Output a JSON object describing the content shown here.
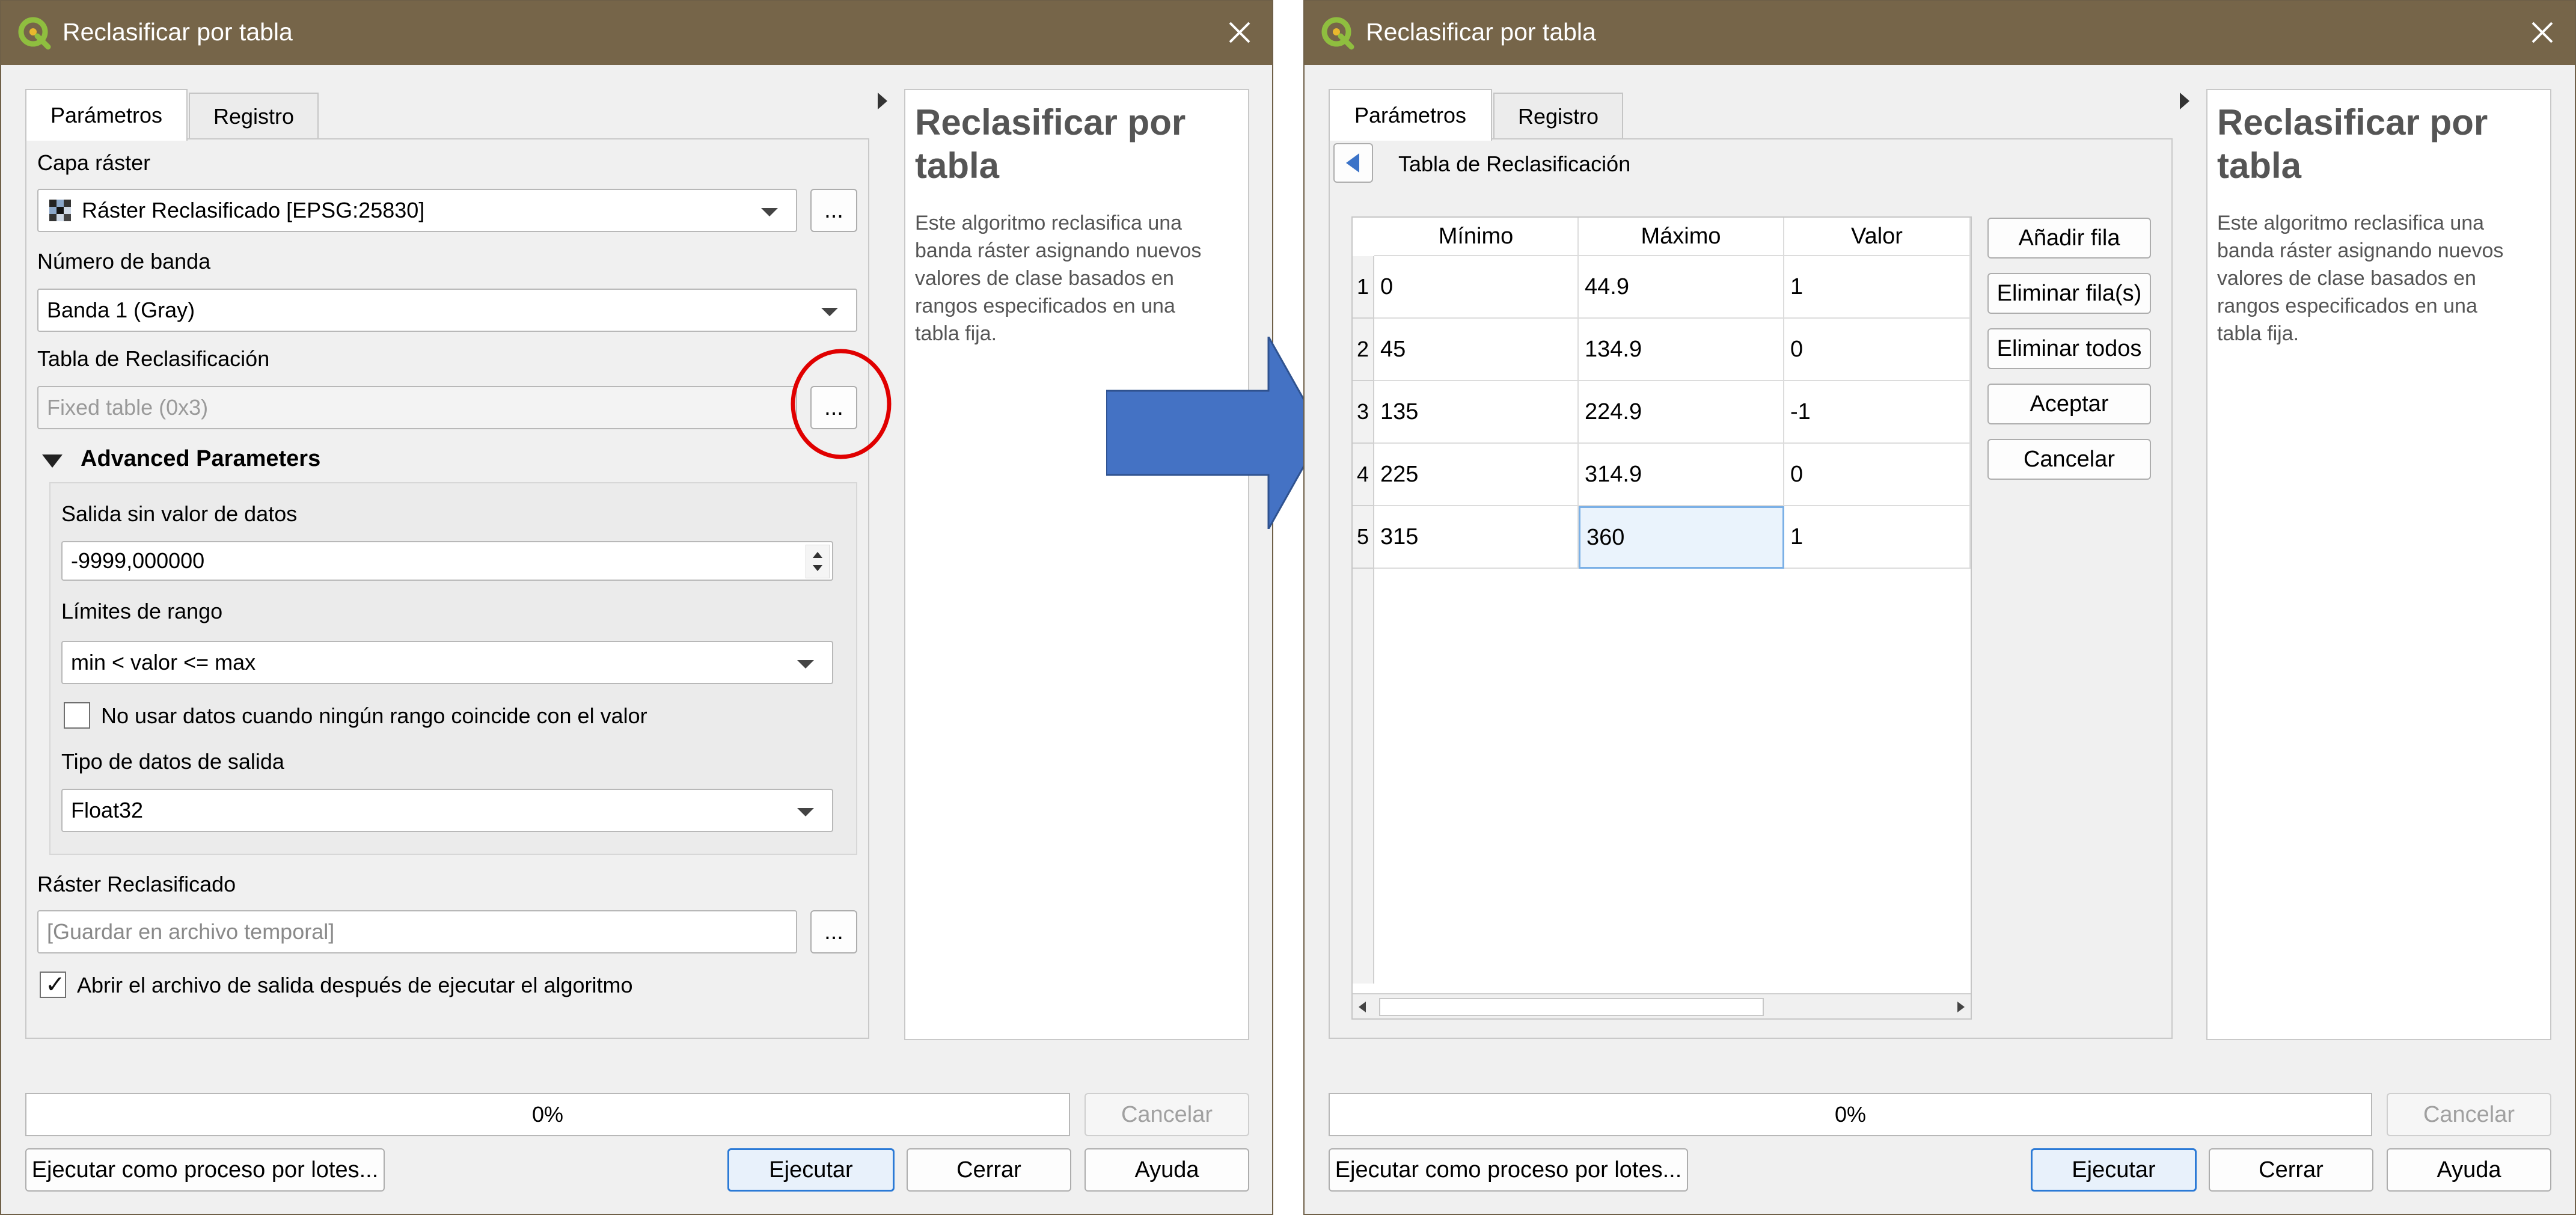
{
  "left_dialog": {
    "title": "Reclasificar por tabla",
    "tabs": [
      "Parámetros",
      "Registro"
    ],
    "capa_raster": {
      "label": "Capa ráster",
      "value": "Ráster Reclasificado [EPSG:25830]"
    },
    "numero_banda": {
      "label": "Número de banda",
      "value": "Banda 1 (Gray)"
    },
    "tabla": {
      "label": "Tabla de Reclasificación",
      "value": "Fixed table (0x3)"
    },
    "browse_label": "...",
    "advanced": {
      "header": "Advanced Parameters",
      "nodata": {
        "label": "Salida sin valor de datos",
        "value": "-9999,000000"
      },
      "limites": {
        "label": "Límites de rango",
        "value": "min < valor <= max"
      },
      "no_usar": {
        "label": "No usar datos cuando ningún rango coincide con el valor",
        "checked": false
      },
      "tipo": {
        "label": "Tipo de datos de salida",
        "value": "Float32"
      }
    },
    "raster_out": {
      "label": "Ráster Reclasificado",
      "placeholder": "[Guardar en archivo temporal]"
    },
    "abrir": {
      "label": "Abrir el archivo de salida después de ejecutar el algoritmo",
      "checked": true
    },
    "progress": "0%",
    "cancel_label": "Cancelar",
    "batch_label": "Ejecutar como proceso por lotes...",
    "run_label": "Ejecutar",
    "close_label": "Cerrar",
    "help_label": "Ayuda",
    "help": {
      "title_lines": [
        "Reclasificar por",
        "tabla"
      ],
      "text_lines": [
        "Este algoritmo reclasifica una",
        "banda ráster asignando nuevos",
        "valores de clase basados en",
        "rangos especificados en una",
        "tabla fija."
      ]
    }
  },
  "right_dialog": {
    "title": "Reclasificar por tabla",
    "tabs": [
      "Parámetros",
      "Registro"
    ],
    "panel_title": "Tabla de Reclasificación",
    "columns": [
      "Mínimo",
      "Máximo",
      "Valor"
    ],
    "rows": [
      {
        "n": "1",
        "min": "0",
        "max": "44.9",
        "val": "1"
      },
      {
        "n": "2",
        "min": "45",
        "max": "134.9",
        "val": "0"
      },
      {
        "n": "3",
        "min": "135",
        "max": "224.9",
        "val": "-1"
      },
      {
        "n": "4",
        "min": "225",
        "max": "314.9",
        "val": "0"
      },
      {
        "n": "5",
        "min": "315",
        "max": "360",
        "val": "1"
      }
    ],
    "side_buttons": [
      "Añadir fila",
      "Eliminar fila(s)",
      "Eliminar todos",
      "Aceptar",
      "Cancelar"
    ],
    "progress": "0%",
    "cancel_label": "Cancelar",
    "batch_label": "Ejecutar como proceso por lotes...",
    "run_label": "Ejecutar",
    "close_label": "Cerrar",
    "help_label": "Ayuda",
    "help": {
      "title_lines": [
        "Reclasificar por",
        "tabla"
      ],
      "text_lines": [
        "Este algoritmo reclasifica una",
        "banda ráster asignando nuevos",
        "valores de clase basados en",
        "rangos especificados en una",
        "tabla fija."
      ]
    }
  },
  "colors": {
    "titlebar": "#766549",
    "arrow": "#4472c4",
    "highlight_circle": "#e00000",
    "default_button_border": "#2b7ad6"
  },
  "icons": [
    "qgis-logo-icon",
    "close-icon",
    "raster-layer-icon",
    "chevron-down-icon",
    "back-arrow-icon",
    "collapse-triangle-icon",
    "spin-arrows-icon"
  ]
}
